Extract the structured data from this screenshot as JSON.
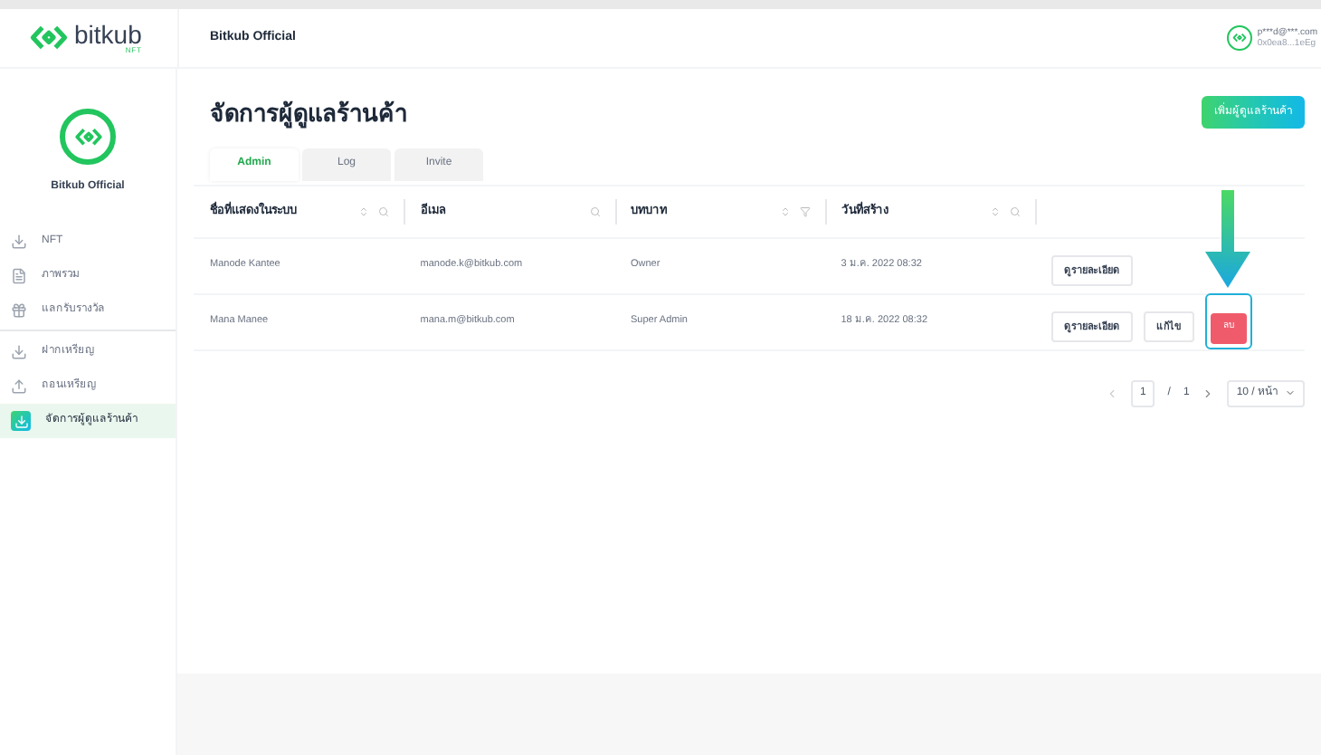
{
  "header": {
    "logo_text": "bitkub",
    "logo_sub": "NFT",
    "shop_name": "Bitkub Official",
    "account_email": "p***d@***.com",
    "account_wallet": "0x0ea8...1eEg"
  },
  "sidebar": {
    "shop_name": "Bitkub Official",
    "groups": [
      [
        {
          "label": "NFT",
          "selected": false
        },
        {
          "label": "ภาพรวม",
          "selected": false
        },
        {
          "label": "แลกรับรางวัล",
          "selected": false
        }
      ],
      [
        {
          "label": "ฝากเหรียญ",
          "selected": false
        },
        {
          "label": "ถอนเหรียญ",
          "selected": false
        },
        {
          "label": "จัดการผู้ดูแลร้านค้า",
          "selected": true
        }
      ]
    ]
  },
  "page": {
    "title": "จัดการผู้ดูแลร้านค้า",
    "add_button": "เพิ่มผู้ดูแลร้านค้า"
  },
  "tabs": [
    {
      "label": "Admin",
      "selected": true
    },
    {
      "label": "Log",
      "selected": false
    },
    {
      "label": "Invite",
      "selected": false
    }
  ],
  "table": {
    "columns": [
      {
        "label": "ชื่อที่แสดงในระบบ",
        "sort": true,
        "search": true,
        "filter": false
      },
      {
        "label": "อีเมล",
        "sort": false,
        "search": true,
        "filter": false
      },
      {
        "label": "บทบาท",
        "sort": true,
        "search": false,
        "filter": true
      },
      {
        "label": "วันที่สร้าง",
        "sort": true,
        "search": true,
        "filter": false
      }
    ],
    "rows": [
      {
        "cells": [
          "Manode Kantee",
          "manode.k@bitkub.com",
          "Owner",
          "3 ม.ค. 2022 08:32"
        ],
        "actions": [
          {
            "kind": "default",
            "label": "ดูรายละเอียด",
            "highlighted": false
          }
        ]
      },
      {
        "cells": [
          "Mana Manee",
          "mana.m@bitkub.com",
          "Super Admin",
          "18 ม.ค. 2022 08:32"
        ],
        "actions": [
          {
            "kind": "default",
            "label": "ดูรายละเอียด",
            "highlighted": false
          },
          {
            "kind": "default",
            "label": "แก้ไข",
            "highlighted": false
          },
          {
            "kind": "danger",
            "label": "ลบ",
            "highlighted": true
          }
        ]
      }
    ]
  },
  "pagination": {
    "current": "1",
    "separator": "/",
    "total": "1",
    "page_size": "10 / หน้า"
  }
}
